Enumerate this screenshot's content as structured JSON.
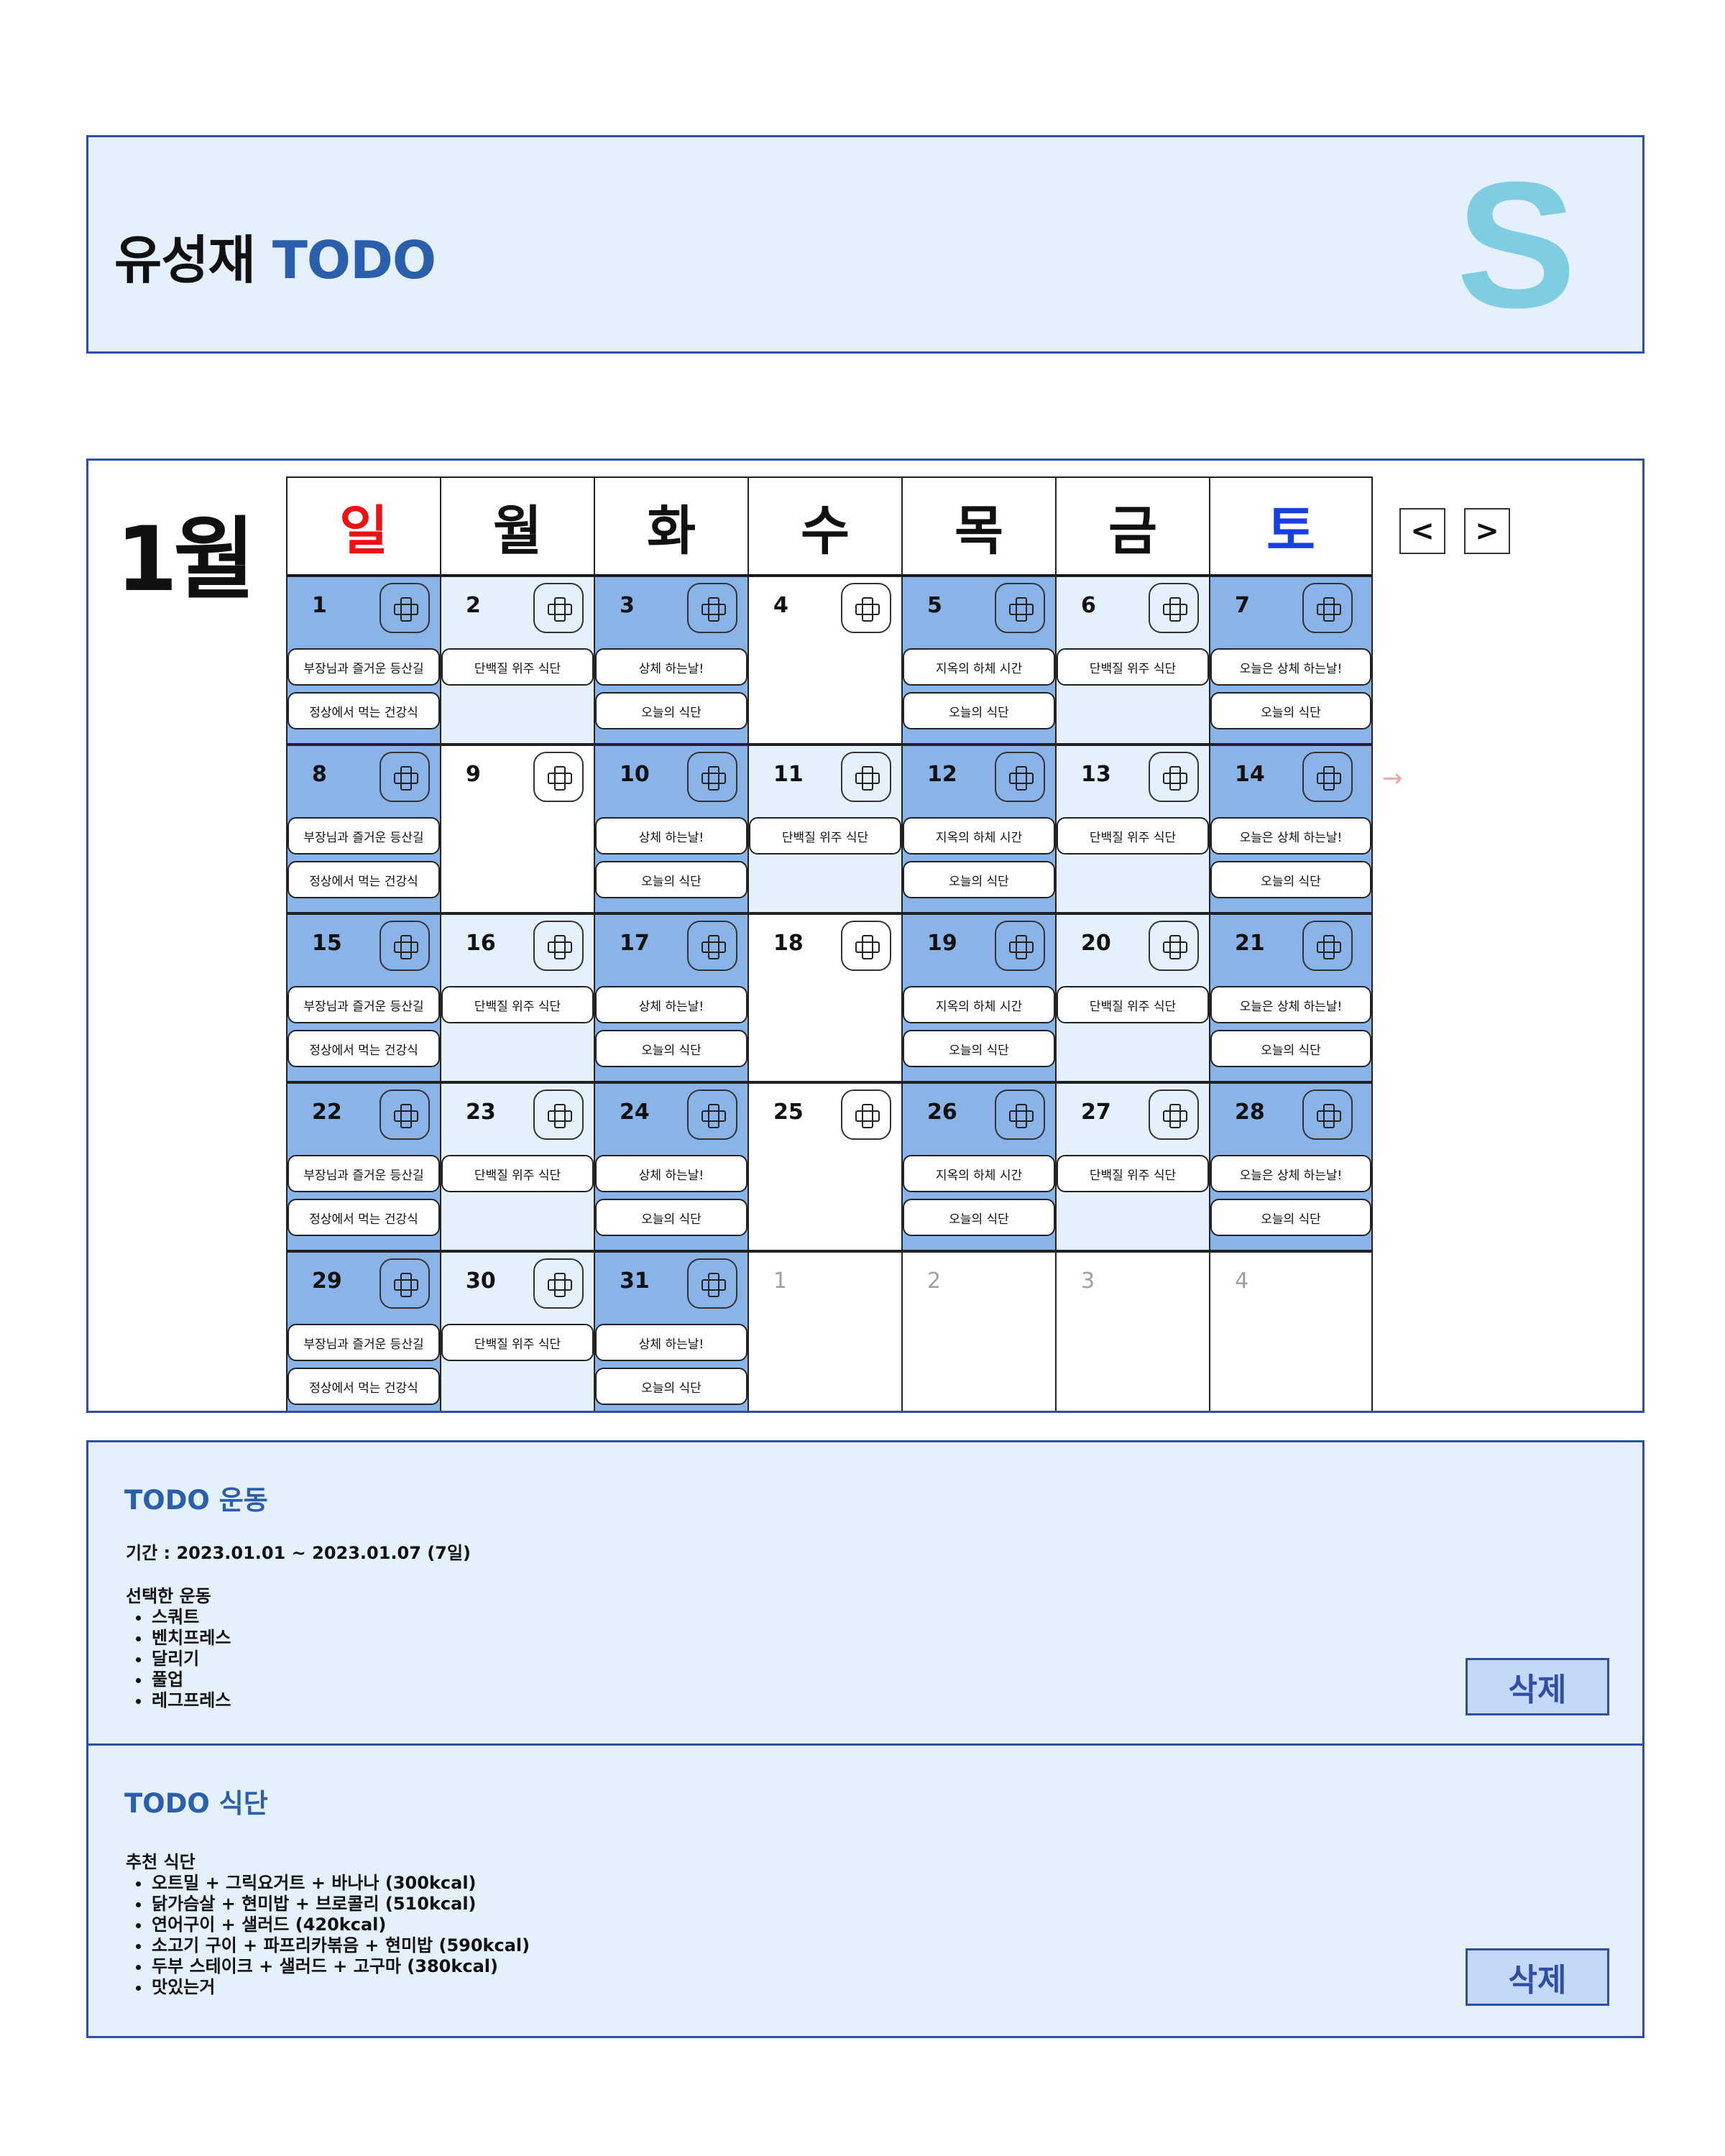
{
  "header": {
    "owner": "유성재",
    "app": "TODO",
    "logo_letter": "S"
  },
  "calendar": {
    "month_label": "1월",
    "weekdays": [
      "일",
      "월",
      "화",
      "수",
      "목",
      "금",
      "토"
    ],
    "prev_label": "<",
    "next_label": ">",
    "arrow_hint": "→",
    "weeks": [
      [
        {
          "day": "1",
          "tone": "dark",
          "items": [
            "부장님과 즐거운 등산길",
            "정상에서 먹는 건강식"
          ]
        },
        {
          "day": "2",
          "tone": "light",
          "items": [
            "단백질 위주 식단"
          ]
        },
        {
          "day": "3",
          "tone": "dark",
          "items": [
            "상체 하는날!",
            "오늘의 식단"
          ]
        },
        {
          "day": "4",
          "tone": "white",
          "items": []
        },
        {
          "day": "5",
          "tone": "dark",
          "items": [
            "지옥의 하체 시간",
            "오늘의 식단"
          ]
        },
        {
          "day": "6",
          "tone": "light",
          "items": [
            "단백질 위주 식단"
          ]
        },
        {
          "day": "7",
          "tone": "dark",
          "items": [
            "오늘은 상체 하는날!",
            "오늘의 식단"
          ]
        }
      ],
      [
        {
          "day": "8",
          "tone": "dark",
          "items": [
            "부장님과 즐거운 등산길",
            "정상에서 먹는 건강식"
          ]
        },
        {
          "day": "9",
          "tone": "white",
          "items": []
        },
        {
          "day": "10",
          "tone": "dark",
          "items": [
            "상체 하는날!",
            "오늘의 식단"
          ]
        },
        {
          "day": "11",
          "tone": "light",
          "items": [
            "단백질 위주 식단"
          ]
        },
        {
          "day": "12",
          "tone": "dark",
          "items": [
            "지옥의 하체 시간",
            "오늘의 식단"
          ]
        },
        {
          "day": "13",
          "tone": "light",
          "items": [
            "단백질 위주 식단"
          ]
        },
        {
          "day": "14",
          "tone": "dark",
          "items": [
            "오늘은 상체 하는날!",
            "오늘의 식단"
          ]
        }
      ],
      [
        {
          "day": "15",
          "tone": "dark",
          "items": [
            "부장님과 즐거운 등산길",
            "정상에서 먹는 건강식"
          ]
        },
        {
          "day": "16",
          "tone": "light",
          "items": [
            "단백질 위주 식단"
          ]
        },
        {
          "day": "17",
          "tone": "dark",
          "items": [
            "상체 하는날!",
            "오늘의 식단"
          ]
        },
        {
          "day": "18",
          "tone": "white",
          "items": []
        },
        {
          "day": "19",
          "tone": "dark",
          "items": [
            "지옥의 하체 시간",
            "오늘의 식단"
          ]
        },
        {
          "day": "20",
          "tone": "light",
          "items": [
            "단백질 위주 식단"
          ]
        },
        {
          "day": "21",
          "tone": "dark",
          "items": [
            "오늘은 상체 하는날!",
            "오늘의 식단"
          ]
        }
      ],
      [
        {
          "day": "22",
          "tone": "dark",
          "items": [
            "부장님과 즐거운 등산길",
            "정상에서 먹는 건강식"
          ]
        },
        {
          "day": "23",
          "tone": "light",
          "items": [
            "단백질 위주 식단"
          ]
        },
        {
          "day": "24",
          "tone": "dark",
          "items": [
            "상체 하는날!",
            "오늘의 식단"
          ]
        },
        {
          "day": "25",
          "tone": "white",
          "items": []
        },
        {
          "day": "26",
          "tone": "dark",
          "items": [
            "지옥의 하체 시간",
            "오늘의 식단"
          ]
        },
        {
          "day": "27",
          "tone": "light",
          "items": [
            "단백질 위주 식단"
          ]
        },
        {
          "day": "28",
          "tone": "dark",
          "items": [
            "오늘은 상체 하는날!",
            "오늘의 식단"
          ]
        }
      ],
      [
        {
          "day": "29",
          "tone": "dark",
          "items": [
            "부장님과 즐거운 등산길",
            "정상에서 먹는 건강식"
          ]
        },
        {
          "day": "30",
          "tone": "light",
          "items": [
            "단백질 위주 식단"
          ]
        },
        {
          "day": "31",
          "tone": "dark",
          "items": [
            "상체 하는날!",
            "오늘의 식단"
          ]
        },
        {
          "day": "1",
          "tone": "muted",
          "items": []
        },
        {
          "day": "2",
          "tone": "muted",
          "items": []
        },
        {
          "day": "3",
          "tone": "muted",
          "items": []
        },
        {
          "day": "4",
          "tone": "muted",
          "items": []
        }
      ]
    ]
  },
  "todo_exercise": {
    "title": "TODO 운동",
    "period": "기간 : 2023.01.01 ~ 2023.01.07 (7일)",
    "list_title": "선택한 운동",
    "items": [
      "스쿼트",
      "벤치프레스",
      "달리기",
      "풀업",
      "레그프레스"
    ],
    "delete_label": "삭제"
  },
  "todo_meal": {
    "title": "TODO 식단",
    "list_title": "추천 식단",
    "items": [
      "오트밀 + 그릭요거트 + 바나나 (300kcal)",
      "닭가슴살 + 현미밥 + 브로콜리 (510kcal)",
      "연어구이 + 샐러드 (420kcal)",
      "소고기 구이 + 파프리카볶음 + 현미밥 (590kcal)",
      "두부 스테이크 + 샐러드 + 고구마 (380kcal)",
      "맛있는거"
    ],
    "delete_label": "삭제"
  },
  "colors": {
    "panel_bg": "#e4f0fc",
    "panel_border": "#2f4ea8",
    "accent_text": "#2b5fab",
    "logo": "#7fcde3",
    "cell_dark": "#8ab4e8",
    "cell_light": "#e4f0fc",
    "sunday": "#ee1111",
    "saturday": "#1a3fe0"
  }
}
